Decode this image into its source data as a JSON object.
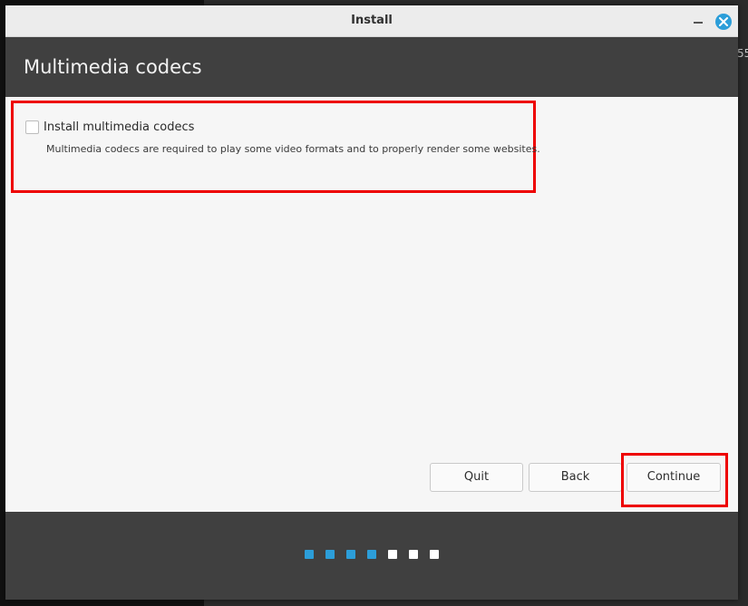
{
  "desktop": {
    "edge_text": "55"
  },
  "window": {
    "title": "Install"
  },
  "page": {
    "title": "Multimedia codecs"
  },
  "option": {
    "label": "Install multimedia codecs",
    "checked": false,
    "description": "Multimedia codecs are required to play some video formats and to properly render some websites."
  },
  "buttons": {
    "quit": "Quit",
    "back": "Back",
    "continue": "Continue"
  },
  "progress": {
    "total_steps": 7,
    "completed_steps": 4,
    "done_color": "#2c9ed9",
    "pending_color": "#ffffff"
  },
  "colors": {
    "accent": "#2c9ed9",
    "header_bg": "#404040",
    "highlight": "#ee0000"
  }
}
